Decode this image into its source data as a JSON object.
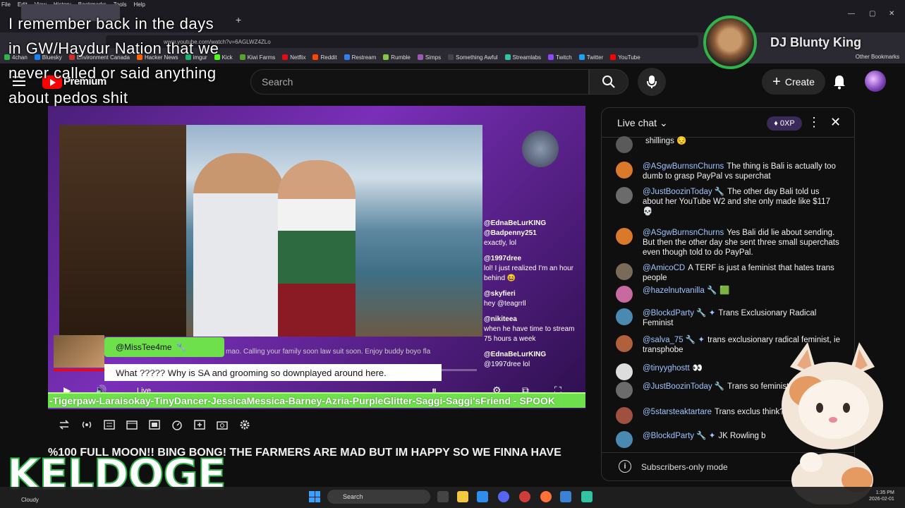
{
  "browser": {
    "menu": [
      "File",
      "Edit",
      "View",
      "History",
      "Bookmarks",
      "Tools",
      "Help"
    ],
    "url": "www.youtube.com/watch?v=6AGLWZ4ZLo",
    "bookmarks": [
      {
        "label": "4chan",
        "color": "#2fb34a"
      },
      {
        "label": "Bluesky",
        "color": "#1185fe"
      },
      {
        "label": "Environment Canada",
        "color": "#d32f2f"
      },
      {
        "label": "Hacker News",
        "color": "#ff6600"
      },
      {
        "label": "imgur",
        "color": "#1bb76e"
      },
      {
        "label": "Kick",
        "color": "#53fc18"
      },
      {
        "label": "Kiwi Farms",
        "color": "#5aa02c"
      },
      {
        "label": "Netflix",
        "color": "#e50914"
      },
      {
        "label": "Reddit",
        "color": "#ff4500"
      },
      {
        "label": "Restream",
        "color": "#2f80ed"
      },
      {
        "label": "Rumble",
        "color": "#85c742"
      },
      {
        "label": "Simps",
        "color": "#9b59b6"
      },
      {
        "label": "Something Awful",
        "color": "#444444"
      },
      {
        "label": "Streamlabs",
        "color": "#31c3a2"
      },
      {
        "label": "Twitch",
        "color": "#9146ff"
      },
      {
        "label": "Twitter",
        "color": "#1da1f2"
      },
      {
        "label": "YouTube",
        "color": "#ff0000"
      }
    ],
    "other_bookmarks": "Other Bookmarks"
  },
  "overlay": {
    "caption": "I remember back in the days in GW/Haydur Nation that we never called or said anything about pedos shit",
    "streamer_name": "DJ Blunty King",
    "watermark": "KELDOGE"
  },
  "header": {
    "brand": "Premium",
    "search_placeholder": "Search",
    "create_label": "Create"
  },
  "video": {
    "superchat_user": "@MissTee4me",
    "superchat_message": "What ????? Why is SA and grooming so downplayed around here.",
    "superchat_scroll": "mao. Calling your family soon law suit soon. Enjoy buddy boyo fla",
    "live_label": "Live",
    "progress_fraction": 0.12,
    "ticker": "-Tigerpaw-Laraisokay-TinyDancer-JessicaMessica-Barney-Azria-PurpleGlitter-Saggi-Saggi'sFriend - SPOOK",
    "onscreen_chat": [
      {
        "name": "@EdnaBeLurKING",
        "text": ""
      },
      {
        "name": "@Badpenny251",
        "text": "exactly, lol"
      },
      {
        "name": "@1997dree",
        "text": "lol! I just realized I'm an hour behind 😆"
      },
      {
        "name": "@skyfieri",
        "text": "hey @teagrrll"
      },
      {
        "name": "@nikiteea",
        "text": "when he have time to stream 75 hours a week"
      },
      {
        "name": "@EdnaBeLurKING",
        "text": "@1997dree lol"
      }
    ],
    "title": "%100 FULL MOON!! BING BONG! THE FARMERS ARE MAD BUT IM HAPPY SO WE FINNA HAVE"
  },
  "chat": {
    "title": "Live chat",
    "xp": "0XP",
    "messages": [
      {
        "author": "",
        "text": "shillings 😔",
        "avatar": "#5a5a5a"
      },
      {
        "author": "@ASgwBurnsnChurns",
        "text": "The thing is Bali is actually too dumb to grasp PayPal vs superchat",
        "avatar": "#d97a2b"
      },
      {
        "author": "@JustBoozinToday 🔧",
        "text": "The other day Bali told us about her YouTube W2 and she only made like $117 💀",
        "avatar": "#6b6b6b"
      },
      {
        "author": "@ASgwBurnsnChurns",
        "text": "Yes Bali did lie about sending. But then the other day she sent three small superchats even though told to do PayPal.",
        "avatar": "#d97a2b"
      },
      {
        "author": "@AmicoCD",
        "text": "A TERF is just a feminist that hates trans people",
        "avatar": "#7a6a5a"
      },
      {
        "author": "@hazelnutvanilla 🔧",
        "text": "🟩",
        "avatar": "#c86aa0"
      },
      {
        "author": "@BlockdParty 🔧 ✦",
        "text": "Trans Exclusionary Radical Feminist",
        "avatar": "#4a8ab0"
      },
      {
        "author": "@salva_75 🔧 ✦",
        "text": "trans exclusionary radical feminist, ie transphobe",
        "avatar": "#b0603a"
      },
      {
        "author": "@tinyyghostt",
        "text": "👀",
        "avatar": "#dddddd"
      },
      {
        "author": "@JustBoozinToday 🔧",
        "text": "Trans so feminist",
        "avatar": "#6b6b6b"
      },
      {
        "author": "@5starsteaktartare",
        "text": "Trans exclus think?",
        "avatar": "#a05040"
      },
      {
        "author": "@BlockdParty 🔧 ✦",
        "text": "JK Rowling b",
        "avatar": "#4a8ab0"
      }
    ],
    "footer": "Subscribers-only mode"
  },
  "taskbar": {
    "weather": "Cloudy",
    "search_label": "Search",
    "time": "1:35 PM",
    "date": "2026-02-01"
  }
}
